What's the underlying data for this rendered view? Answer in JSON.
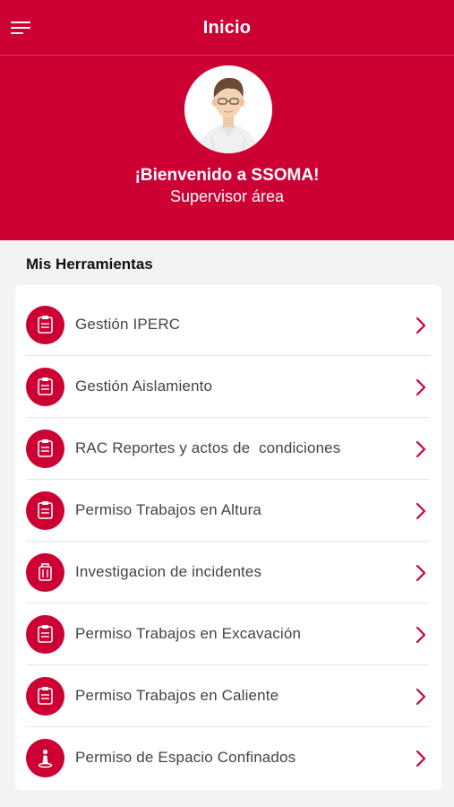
{
  "header": {
    "title": "Inicio",
    "menu_icon": "hamburger-menu-icon"
  },
  "hero": {
    "welcome": "¡Bienvenido a SSOMA!",
    "role": "Supervisor área",
    "avatar": "user-avatar"
  },
  "tools": {
    "section_title": "Mis Herramientas",
    "items": [
      {
        "label": "Gestión IPERC",
        "icon": "clipboard-icon"
      },
      {
        "label": "Gestión Aislamiento",
        "icon": "clipboard-icon"
      },
      {
        "label": "RAC Reportes y actos de  condiciones",
        "icon": "clipboard-icon"
      },
      {
        "label": "Permiso Trabajos en Altura",
        "icon": "clipboard-icon"
      },
      {
        "label": "Investigacion de incidentes",
        "icon": "briefcase-icon"
      },
      {
        "label": "Permiso Trabajos en Excavación",
        "icon": "clipboard-icon"
      },
      {
        "label": "Permiso Trabajos en Caliente",
        "icon": "clipboard-icon"
      },
      {
        "label": "Permiso de Espacio Confinados",
        "icon": "person-location-icon"
      }
    ]
  },
  "colors": {
    "primary": "#cc0033",
    "background": "#f3f3f3",
    "card": "#ffffff",
    "text": "#444444"
  }
}
